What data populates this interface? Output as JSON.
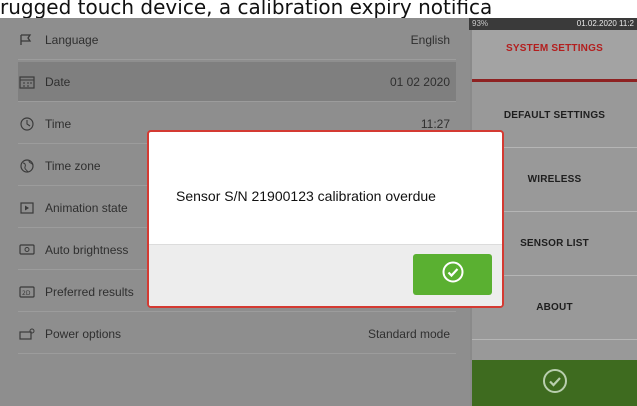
{
  "caption": "rugged touch device, a calibration expiry notifica",
  "status_bar": {
    "battery": "93%",
    "clock": "01.02.2020 11:2"
  },
  "settings": [
    {
      "icon": "flag-icon",
      "label": "Language",
      "value": "English"
    },
    {
      "icon": "calendar-icon",
      "label": "Date",
      "value": "01 02 2020"
    },
    {
      "icon": "clock-icon",
      "label": "Time",
      "value": "11:27"
    },
    {
      "icon": "globe-icon",
      "label": "Time zone",
      "value": ""
    },
    {
      "icon": "animation-icon",
      "label": "Animation state",
      "value": ""
    },
    {
      "icon": "brightness-icon",
      "label": "Auto brightness",
      "value": ""
    },
    {
      "icon": "results-icon",
      "label": "Preferred results",
      "value": ""
    },
    {
      "icon": "power-icon",
      "label": "Power options",
      "value": "Standard mode"
    }
  ],
  "menu": [
    {
      "label": "SYSTEM SETTINGS",
      "active": true
    },
    {
      "label": "DEFAULT SETTINGS",
      "active": false
    },
    {
      "label": "WIRELESS",
      "active": false
    },
    {
      "label": "SENSOR LIST",
      "active": false
    },
    {
      "label": "ABOUT",
      "active": false
    }
  ],
  "dialog": {
    "message": "Sensor S/N 21900123 calibration overdue",
    "ok_icon": "check-circle-icon"
  },
  "colors": {
    "dialog_border": "#d43a32",
    "ok_button": "#5ab031",
    "active_menu_text": "#b31e1e",
    "confirm_bar": "#3e6b1f"
  }
}
